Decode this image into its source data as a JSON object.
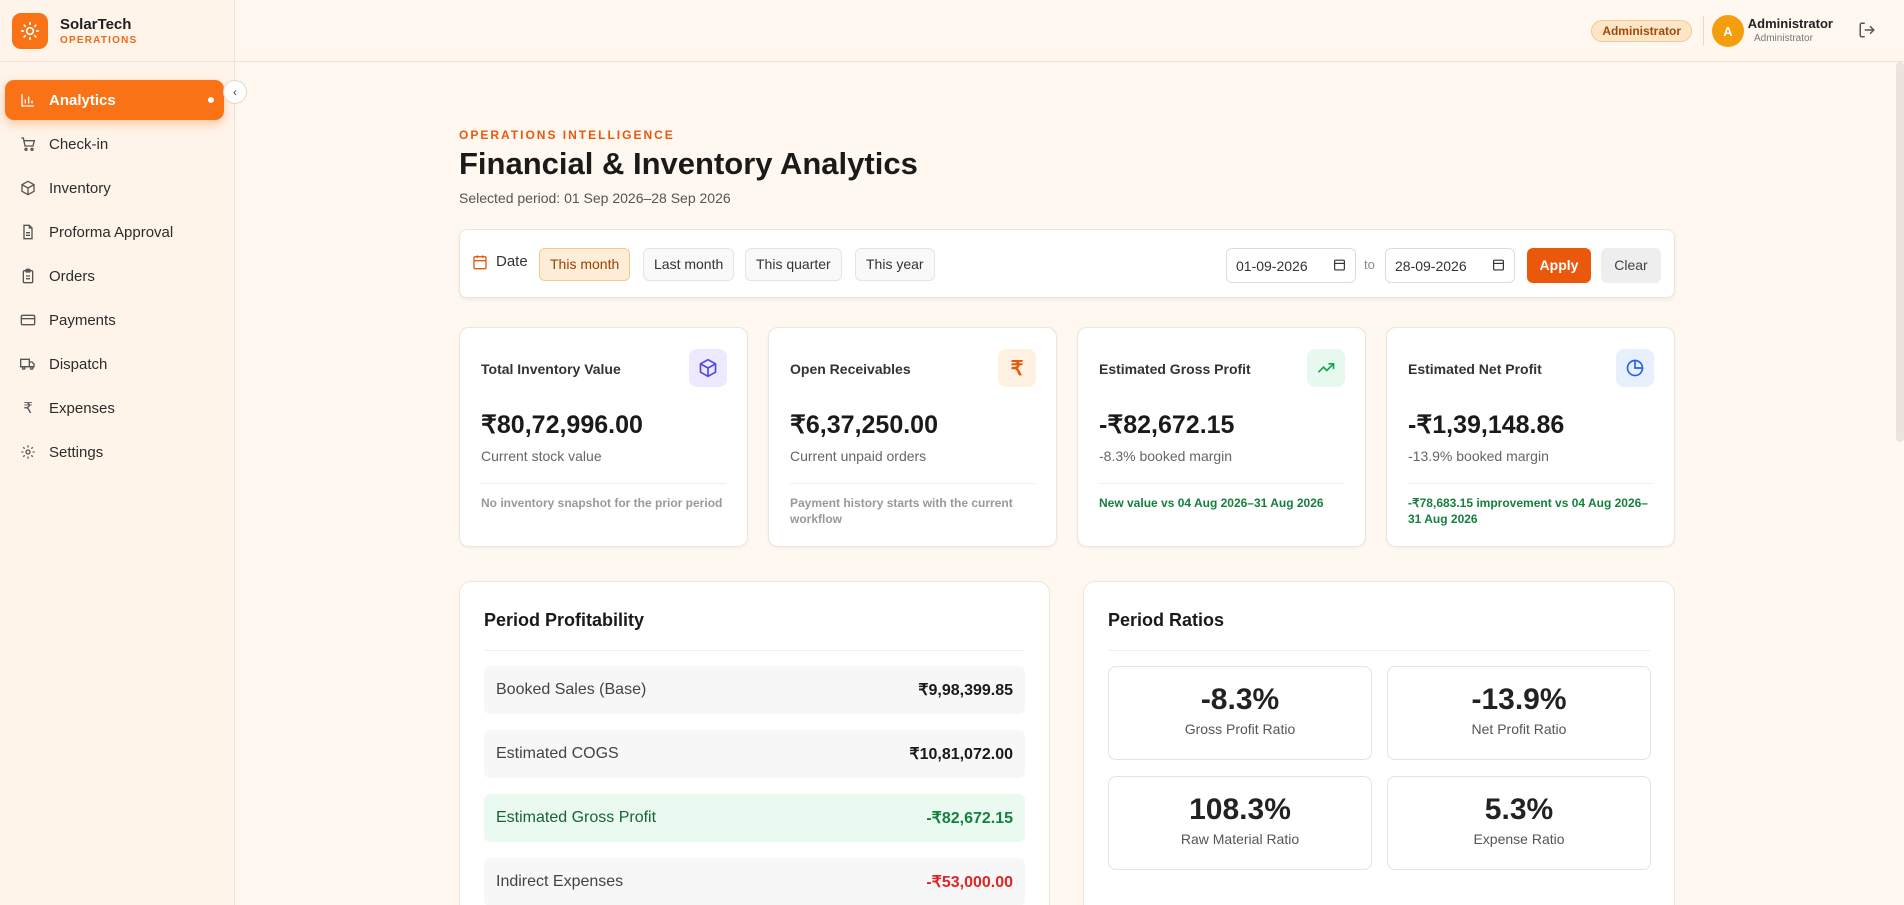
{
  "brand": {
    "name": "SolarTech",
    "sub": "OPERATIONS"
  },
  "sidebar": {
    "items": [
      {
        "label": "Analytics",
        "icon": "bar-chart-icon",
        "active": true
      },
      {
        "label": "Check-in",
        "icon": "cart-icon"
      },
      {
        "label": "Inventory",
        "icon": "box-icon"
      },
      {
        "label": "Proforma Approval",
        "icon": "document-icon"
      },
      {
        "label": "Orders",
        "icon": "clipboard-icon"
      },
      {
        "label": "Payments",
        "icon": "credit-card-icon"
      },
      {
        "label": "Dispatch",
        "icon": "truck-icon"
      },
      {
        "label": "Expenses",
        "icon": "rupee-icon"
      },
      {
        "label": "Settings",
        "icon": "gear-icon"
      }
    ]
  },
  "header": {
    "role_badge": "Administrator",
    "avatar_initial": "A",
    "user_name": "Administrator",
    "user_role": "Administrator"
  },
  "page": {
    "eyebrow": "OPERATIONS INTELLIGENCE",
    "title": "Financial & Inventory Analytics",
    "period": "Selected period: 01 Sep 2026–28 Sep 2026"
  },
  "filters": {
    "label": "Date",
    "chips": [
      "This month",
      "Last month",
      "This quarter",
      "This year"
    ],
    "active_chip": "This month",
    "from": "01-09-2026",
    "to_label": "to",
    "to": "28-09-2026",
    "apply": "Apply",
    "clear": "Clear"
  },
  "kpis": [
    {
      "title": "Total Inventory Value",
      "value": "₹80,72,996.00",
      "sub": "Current stock value",
      "note": "No inventory snapshot for the prior period",
      "icon": "cube-icon"
    },
    {
      "title": "Open Receivables",
      "value": "₹6,37,250.00",
      "sub": "Current unpaid orders",
      "note": "Payment history starts with the current workflow",
      "icon": "rupee-icon"
    },
    {
      "title": "Estimated Gross Profit",
      "value": "-₹82,672.15",
      "sub": "-8.3% booked margin",
      "note": "New value vs 04 Aug 2026–31 Aug 2026",
      "icon": "trending-up-icon"
    },
    {
      "title": "Estimated Net Profit",
      "value": "-₹1,39,148.86",
      "sub": "-13.9% booked margin",
      "note": "-₹78,683.15 improvement vs 04 Aug 2026–31 Aug 2026",
      "icon": "pie-chart-icon"
    }
  ],
  "profitability": {
    "title": "Period Profitability",
    "rows": [
      {
        "label": "Booked Sales (Base)",
        "value": "₹9,98,399.85"
      },
      {
        "label": "Estimated COGS",
        "value": "₹10,81,072.00"
      },
      {
        "label": "Estimated Gross Profit",
        "value": "-₹82,672.15"
      },
      {
        "label": "Indirect Expenses",
        "value": "-₹53,000.00"
      }
    ]
  },
  "ratios": {
    "title": "Period Ratios",
    "items": [
      {
        "value": "-8.3%",
        "label": "Gross Profit Ratio"
      },
      {
        "value": "-13.9%",
        "label": "Net Profit Ratio"
      },
      {
        "value": "108.3%",
        "label": "Raw Material Ratio"
      },
      {
        "value": "5.3%",
        "label": "Expense Ratio"
      }
    ]
  },
  "colors": {
    "accent": "#f97316",
    "accent_dark": "#ea580c",
    "positive": "#15803d",
    "negative": "#dc2626"
  }
}
